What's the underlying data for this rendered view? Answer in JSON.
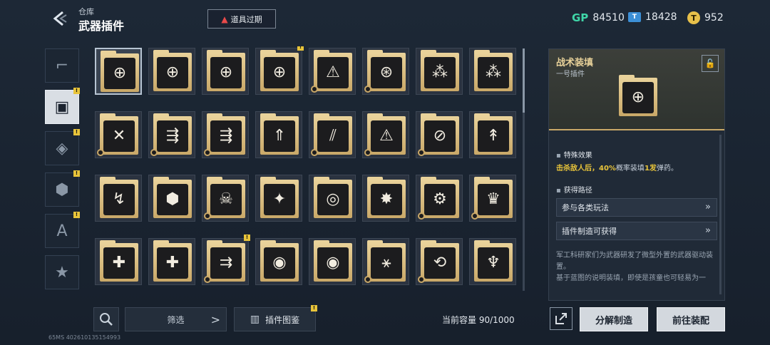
{
  "header": {
    "breadcrumb": "仓库",
    "title": "武器插件",
    "expire_label": "道具过期"
  },
  "currencies": [
    {
      "icon": "gp-icon",
      "symbol": "GP",
      "value": "84510"
    },
    {
      "icon": "ticket-icon",
      "symbol": "T",
      "value": "18428"
    },
    {
      "icon": "coin-icon",
      "symbol": "T",
      "value": "952"
    }
  ],
  "categories": [
    {
      "icon": "gun-icon",
      "glyph": "⌐",
      "badge": false,
      "active": false
    },
    {
      "icon": "chip-icon",
      "glyph": "▣",
      "badge": true,
      "active": true
    },
    {
      "icon": "grenade-icon",
      "glyph": "◈",
      "badge": true,
      "active": false
    },
    {
      "icon": "module-icon",
      "glyph": "⬢",
      "badge": true,
      "active": false
    },
    {
      "icon": "armor-icon",
      "glyph": "A",
      "badge": true,
      "active": false
    },
    {
      "icon": "star-icon",
      "glyph": "★",
      "badge": false,
      "active": false
    }
  ],
  "badge_mark": "!",
  "items": [
    {
      "glyph": "⊕",
      "name": "plugin-scope",
      "badge": false,
      "gear": false,
      "selected": true
    },
    {
      "glyph": "⊕",
      "name": "plugin-scope",
      "badge": false,
      "gear": false
    },
    {
      "glyph": "⊕",
      "name": "plugin-scope",
      "badge": false,
      "gear": false
    },
    {
      "glyph": "⊕",
      "name": "plugin-scope",
      "badge": true,
      "gear": false
    },
    {
      "glyph": "⚠",
      "name": "plugin-ammo-warning",
      "badge": false,
      "gear": true
    },
    {
      "glyph": "⊛",
      "name": "plugin-ammo-target",
      "badge": false,
      "gear": true
    },
    {
      "glyph": "⁂",
      "name": "plugin-rockets",
      "badge": false,
      "gear": false
    },
    {
      "glyph": "⁂",
      "name": "plugin-rockets",
      "badge": false,
      "gear": false
    },
    {
      "glyph": "✕",
      "name": "plugin-cross",
      "badge": false,
      "gear": true
    },
    {
      "glyph": "⇶",
      "name": "plugin-bullets-up",
      "badge": false,
      "gear": true
    },
    {
      "glyph": "⇶",
      "name": "plugin-bullets-up",
      "badge": false,
      "gear": true
    },
    {
      "glyph": "⇑",
      "name": "plugin-lines-up",
      "badge": false,
      "gear": false
    },
    {
      "glyph": "⫽",
      "name": "plugin-slashes",
      "badge": false,
      "gear": true
    },
    {
      "glyph": "⚠",
      "name": "plugin-warning",
      "badge": false,
      "gear": true
    },
    {
      "glyph": "⊘",
      "name": "plugin-no-slash",
      "badge": false,
      "gear": true
    },
    {
      "glyph": "↟",
      "name": "plugin-arrows-up",
      "badge": false,
      "gear": false
    },
    {
      "glyph": "↯",
      "name": "plugin-bolt-up",
      "badge": false,
      "gear": false
    },
    {
      "glyph": "⬢",
      "name": "plugin-hex-shield",
      "badge": false,
      "gear": false
    },
    {
      "glyph": "☠",
      "name": "plugin-skull-target",
      "badge": false,
      "gear": true
    },
    {
      "glyph": "✦",
      "name": "plugin-star-burst",
      "badge": false,
      "gear": false
    },
    {
      "glyph": "◎",
      "name": "plugin-ring",
      "badge": false,
      "gear": false
    },
    {
      "glyph": "✸",
      "name": "plugin-explosion",
      "badge": false,
      "gear": false
    },
    {
      "glyph": "⚙",
      "name": "plugin-gear-gun",
      "badge": false,
      "gear": true
    },
    {
      "glyph": "♛",
      "name": "plugin-crown",
      "badge": false,
      "gear": true
    },
    {
      "glyph": "✚",
      "name": "plugin-medkit",
      "badge": false,
      "gear": false
    },
    {
      "glyph": "✚",
      "name": "plugin-medkit",
      "badge": false,
      "gear": false
    },
    {
      "glyph": "⇉",
      "name": "plugin-bullets-shield",
      "badge": true,
      "gear": true
    },
    {
      "glyph": "◉",
      "name": "plugin-orb",
      "badge": false,
      "gear": false
    },
    {
      "glyph": "◉",
      "name": "plugin-orb",
      "badge": false,
      "gear": false
    },
    {
      "glyph": "⚹",
      "name": "plugin-spin-target",
      "badge": false,
      "gear": true
    },
    {
      "glyph": "⟲",
      "name": "plugin-cycle-up",
      "badge": false,
      "gear": true
    },
    {
      "glyph": "♆",
      "name": "plugin-trident",
      "badge": false,
      "gear": false
    }
  ],
  "toolbar": {
    "filter_label": "筛选",
    "atlas_label": "插件图鉴",
    "capacity": "当前容量 90/1000"
  },
  "footer": {
    "build_id": "65MS  402610135154993"
  },
  "detail": {
    "name": "战术装填",
    "subtitle": "一号插件",
    "effect_title": "特殊效果",
    "effect_prefix": "击杀敌人后，",
    "effect_pct": "40%",
    "effect_mid": "概率装填",
    "effect_count": "1发",
    "effect_suffix": "弹药。",
    "source_title": "获得路径",
    "sources": [
      "参与各类玩法",
      "插件制造可获得"
    ],
    "lore_1": "军工科研家们为武器研发了微型外置的武器驱动装置。",
    "lore_2": "基于蓝图的说明装填，即使是孩童也可轻易为一"
  },
  "actions": {
    "dismantle_label": "分解制造",
    "equip_label": "前往装配"
  }
}
